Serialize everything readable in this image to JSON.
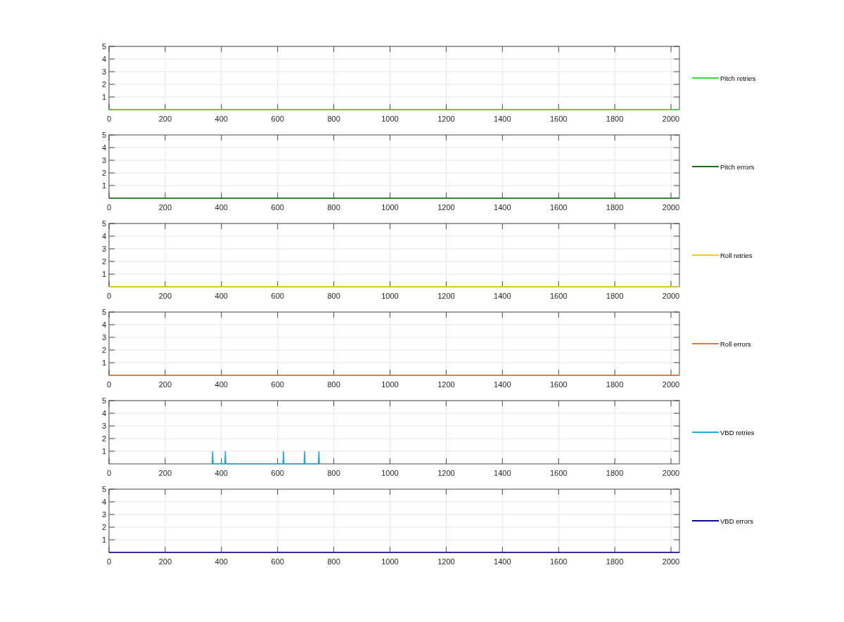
{
  "figure": {
    "charts": [
      {
        "chart_data": {
          "type": "line",
          "grid": true,
          "x": [
            0,
            2030
          ],
          "xlim": [
            0,
            2030
          ],
          "ylim": [
            0,
            5
          ],
          "xticks": [
            0,
            200,
            400,
            600,
            800,
            1000,
            1200,
            1400,
            1600,
            1800,
            2000
          ],
          "yticks": [
            1,
            2,
            3,
            4,
            5
          ],
          "series": [
            {
              "name": "Pitch retries",
              "color": "#33dd33",
              "values": [
                0,
                0
              ]
            }
          ]
        }
      },
      {
        "chart_data": {
          "type": "line",
          "grid": true,
          "x": [
            0,
            2030
          ],
          "xlim": [
            0,
            2030
          ],
          "ylim": [
            0,
            5
          ],
          "xticks": [
            0,
            200,
            400,
            600,
            800,
            1000,
            1200,
            1400,
            1600,
            1800,
            2000
          ],
          "yticks": [
            1,
            2,
            3,
            4,
            5
          ],
          "series": [
            {
              "name": "Pitch errors",
              "color": "#117711",
              "values": [
                0,
                0
              ]
            }
          ]
        }
      },
      {
        "chart_data": {
          "type": "line",
          "grid": true,
          "x": [
            0,
            2030
          ],
          "xlim": [
            0,
            2030
          ],
          "ylim": [
            0,
            5
          ],
          "xticks": [
            0,
            200,
            400,
            600,
            800,
            1000,
            1200,
            1400,
            1600,
            1800,
            2000
          ],
          "yticks": [
            1,
            2,
            3,
            4,
            5
          ],
          "series": [
            {
              "name": "Roll retries",
              "color": "#ffcc00",
              "values": [
                0,
                0
              ]
            }
          ]
        }
      },
      {
        "chart_data": {
          "type": "line",
          "grid": true,
          "x": [
            0,
            2030
          ],
          "xlim": [
            0,
            2030
          ],
          "ylim": [
            0,
            5
          ],
          "xticks": [
            0,
            200,
            400,
            600,
            800,
            1000,
            1200,
            1400,
            1600,
            1800,
            2000
          ],
          "yticks": [
            1,
            2,
            3,
            4,
            5
          ],
          "series": [
            {
              "name": "Roll errors",
              "color": "#ee7722",
              "values": [
                0,
                0
              ]
            }
          ]
        }
      },
      {
        "chart_data": {
          "type": "line",
          "grid": true,
          "x": [
            367,
            369,
            371,
            412,
            414,
            416,
            619,
            621,
            623,
            694,
            696,
            698,
            745,
            747,
            749
          ],
          "xlim": [
            0,
            2030
          ],
          "ylim": [
            0,
            5
          ],
          "xticks": [
            0,
            200,
            400,
            600,
            800,
            1000,
            1200,
            1400,
            1600,
            1800,
            2000
          ],
          "yticks": [
            1,
            2,
            3,
            4,
            5
          ],
          "series": [
            {
              "name": "VBD retries",
              "color": "#22aadd",
              "values": [
                0,
                1,
                0,
                0,
                1,
                0,
                0,
                1,
                0,
                0,
                1,
                0,
                0,
                1,
                0
              ]
            }
          ]
        }
      },
      {
        "chart_data": {
          "type": "line",
          "grid": true,
          "x": [
            0,
            2030
          ],
          "xlim": [
            0,
            2030
          ],
          "ylim": [
            0,
            5
          ],
          "xticks": [
            0,
            200,
            400,
            600,
            800,
            1000,
            1200,
            1400,
            1600,
            1800,
            2000
          ],
          "yticks": [
            1,
            2,
            3,
            4,
            5
          ],
          "series": [
            {
              "name": "VBD errors",
              "color": "#0a0a99",
              "values": [
                0,
                0
              ]
            }
          ]
        }
      }
    ]
  }
}
